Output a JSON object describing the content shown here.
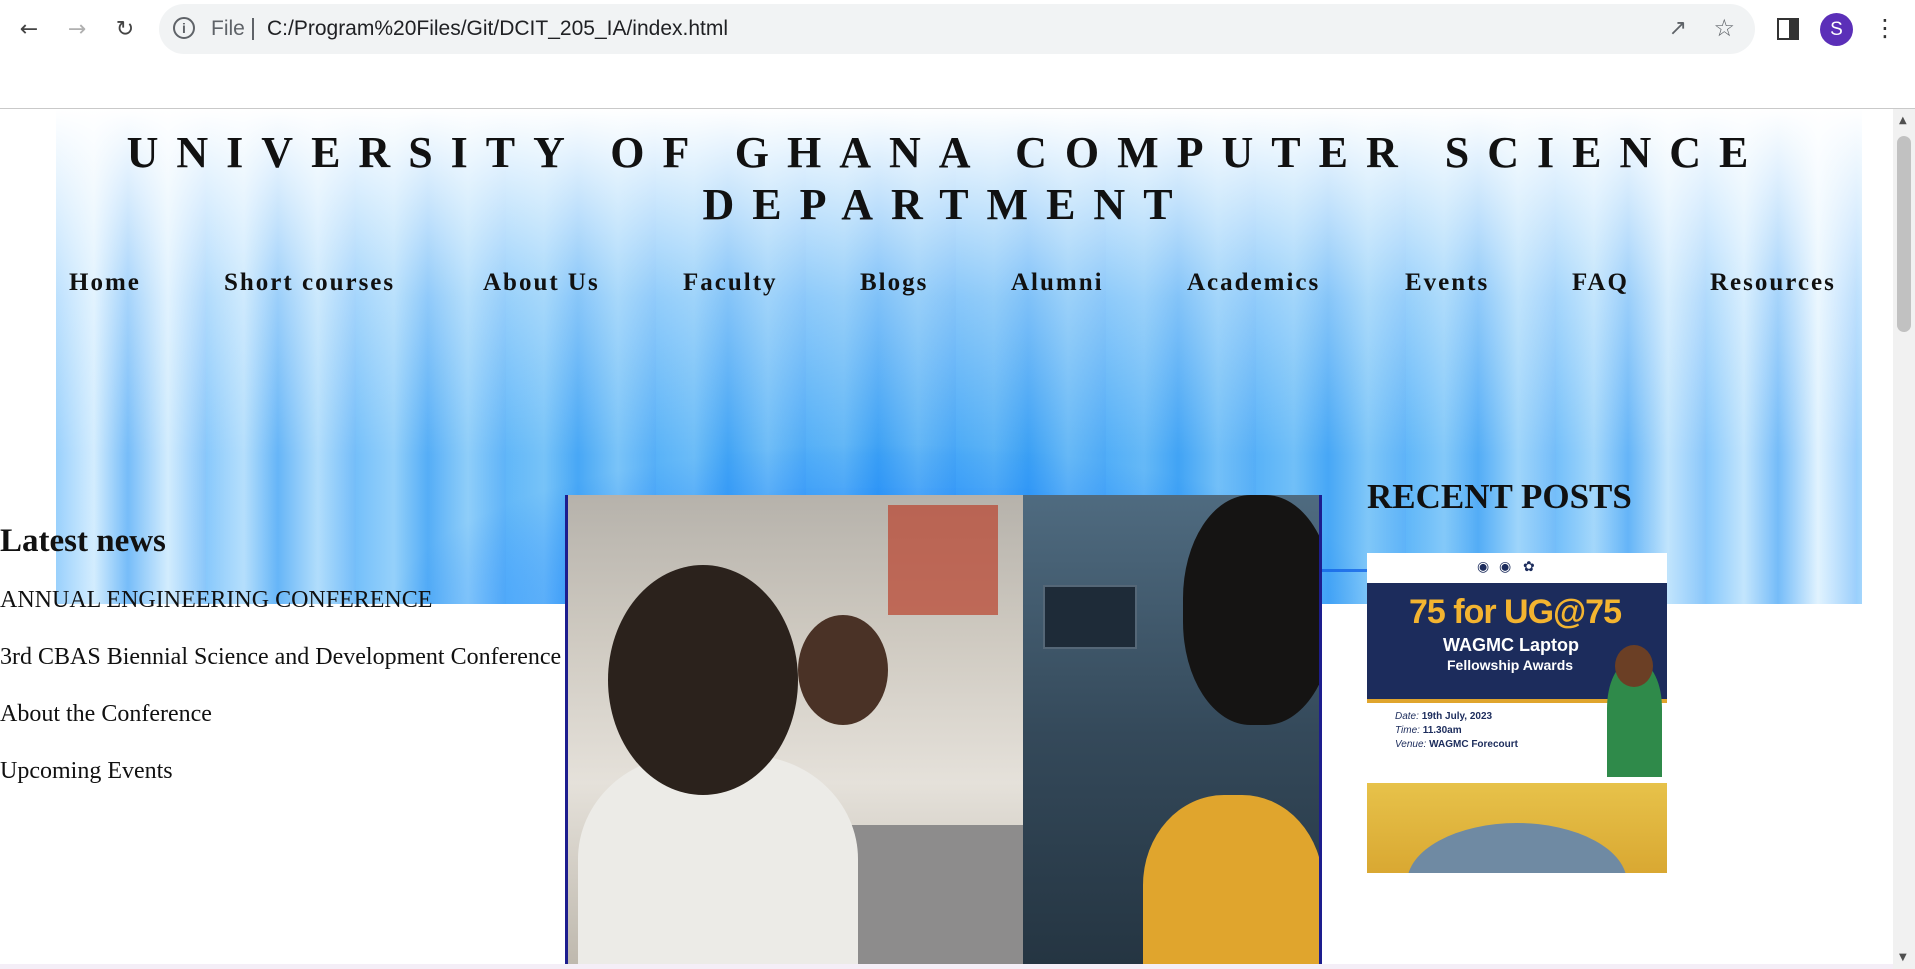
{
  "browser": {
    "address_file_label": "File",
    "url": "C:/Program%20Files/Git/DCIT_205_IA/index.html",
    "profile_initial": "S"
  },
  "site": {
    "title": "UNIVERSITY OF GHANA COMPUTER SCIENCE DEPARTMENT",
    "nav": [
      "Home",
      "Short courses",
      "About Us",
      "Faculty",
      "Blogs",
      "Alumni",
      "Academics",
      "Events",
      "FAQ",
      "Resources"
    ]
  },
  "latest_news": {
    "heading": "Latest news",
    "items": [
      "ANNUAL ENGINEERING CONFERENCE",
      "3rd CBAS Biennial Science and Development Conference",
      "About the Conference",
      "Upcoming Events"
    ]
  },
  "recent_posts": {
    "heading": "RECENT POSTS",
    "poster1": {
      "headline": "75 for UG@75",
      "line1": "WAGMC Laptop",
      "line2": "Fellowship Awards",
      "date_label": "Date:",
      "date": "19th July, 2023",
      "time_label": "Time:",
      "time": "11.30am",
      "venue_label": "Venue:",
      "venue": "WAGMC Forecourt"
    }
  }
}
